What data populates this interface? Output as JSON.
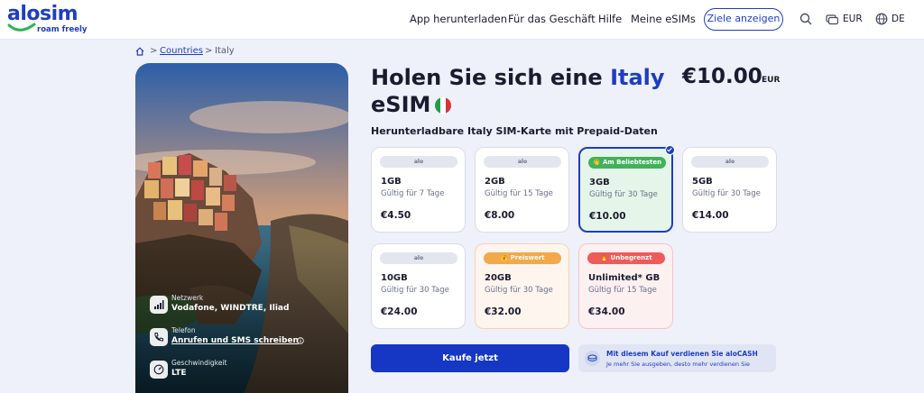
{
  "header": {
    "logo_text": "alosim",
    "logo_tagline": "roam freely",
    "nav": [
      "App herunterladen",
      "Für das Geschäft",
      "Hilfe",
      "Meine eSIMs"
    ],
    "cta": "Ziele anzeigen",
    "currency": "EUR",
    "language": "DE"
  },
  "breadcrumb": {
    "home_icon": "home-icon",
    "separator": ">",
    "countries": "Countries",
    "current": "Italy"
  },
  "specs": [
    {
      "label": "Netzwerk",
      "value": "Vodafone, WINDTRE, Iliad",
      "icon": "signal-icon"
    },
    {
      "label": "Telefon",
      "value": "Anrufen und SMS schreiben",
      "icon": "phone-icon",
      "info_icon": "info-icon"
    },
    {
      "label": "Geschwindigkeit",
      "value": "LTE",
      "icon": "speed-icon"
    }
  ],
  "product": {
    "title_prefix": "Holen Sie sich eine",
    "title_country": "Italy",
    "title_suffix": "eSIM",
    "price": "€10.00",
    "price_currency": "EUR",
    "subtitle": "Herunterladbare Italy SIM-Karte mit Prepaid-Daten"
  },
  "plans": [
    {
      "badge": "alo",
      "size": "1GB",
      "validity": "Gültig für 7 Tage",
      "price": "€4.50"
    },
    {
      "badge": "alo",
      "size": "2GB",
      "validity": "Gültig für 15 Tage",
      "price": "€8.00"
    },
    {
      "badge": "👋 Am Beliebtesten",
      "size": "3GB",
      "validity": "Gültig für 30 Tage",
      "price": "€10.00",
      "selected": true
    },
    {
      "badge": "alo",
      "size": "5GB",
      "validity": "Gültig für 30 Tage",
      "price": "€14.00"
    },
    {
      "badge": "alo",
      "size": "10GB",
      "validity": "Gültig für 30 Tage",
      "price": "€24.00"
    },
    {
      "badge": "💰 Preiswert",
      "size": "20GB",
      "validity": "Gültig für 30 Tage",
      "price": "€32.00"
    },
    {
      "badge": "🔥 Unbegrenzt",
      "size": "Unlimited* GB",
      "validity": "Gültig für 15 Tage",
      "price": "€34.00"
    }
  ],
  "actions": {
    "buy": "Kaufe jetzt",
    "cash_title": "Mit diesem Kauf verdienen Sie aloCASH",
    "cash_subtitle": "Je mehr Sie ausgeben, desto mehr verdienen Sie"
  },
  "colors": {
    "brand": "#1d3ec1",
    "selected_bg": "#e6f5ea",
    "popular_badge": "#3fb25a",
    "value_badge": "#f3a84a",
    "unlimited_badge": "#ef5a5a"
  }
}
